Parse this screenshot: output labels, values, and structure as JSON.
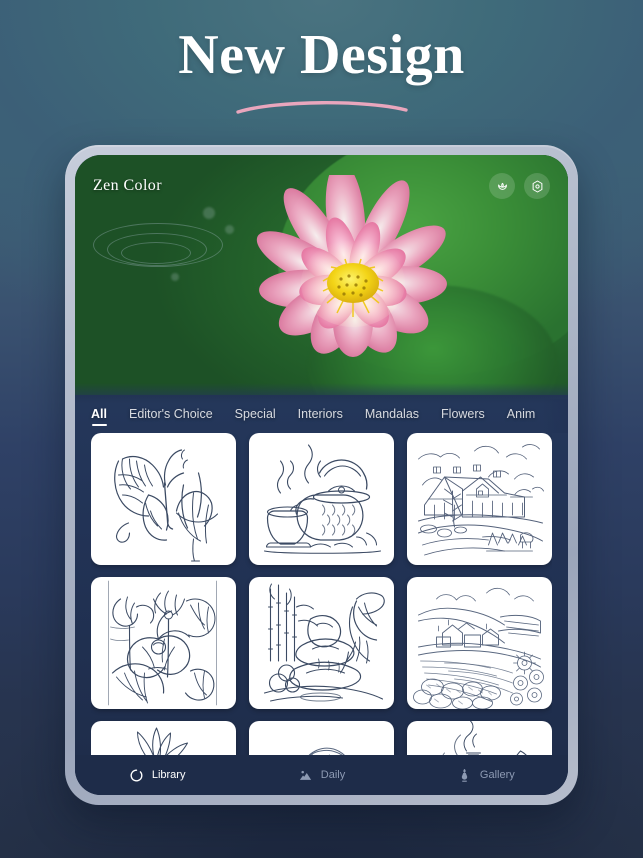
{
  "page": {
    "headline": "New Design",
    "accent_underline_color": "#e9a6bd",
    "background_top_color": "#44707c",
    "background_bottom_color": "#253147"
  },
  "device": {
    "bezel_color": "#aeb7c8",
    "screen_bg_color": "#223356"
  },
  "app": {
    "brand": "Zen Color",
    "topbar": {
      "actions": [
        {
          "name": "lotus-icon",
          "label": "Lotus"
        },
        {
          "name": "gear-icon",
          "label": "Settings"
        }
      ]
    },
    "hero": {
      "subject": "lotus-flower-photo",
      "petal_color": "#ef8fb4",
      "center_color": "#f5d21e",
      "leaf_color": "#3a8f38"
    },
    "tabs": [
      {
        "label": "All",
        "active": true
      },
      {
        "label": "Editor's Choice",
        "active": false
      },
      {
        "label": "Special",
        "active": false
      },
      {
        "label": "Interiors",
        "active": false
      },
      {
        "label": "Mandalas",
        "active": false
      },
      {
        "label": "Flowers",
        "active": false
      },
      {
        "label": "Anim",
        "active": false
      }
    ],
    "gallery": [
      {
        "name": "butterfly-on-tulip"
      },
      {
        "name": "teapot-and-cup"
      },
      {
        "name": "farmhouse-landscape"
      },
      {
        "name": "lotus-flowers"
      },
      {
        "name": "zen-stones-bamboo"
      },
      {
        "name": "farm-field-landscape"
      },
      {
        "name": "daisy-flower"
      },
      {
        "name": "girl-portrait"
      },
      {
        "name": "cabin-with-smoke"
      }
    ],
    "bottom_nav": [
      {
        "label": "Library",
        "icon": "ring-icon",
        "active": true
      },
      {
        "label": "Daily",
        "icon": "mountain-icon",
        "active": false
      },
      {
        "label": "Gallery",
        "icon": "vase-icon",
        "active": false
      }
    ]
  }
}
